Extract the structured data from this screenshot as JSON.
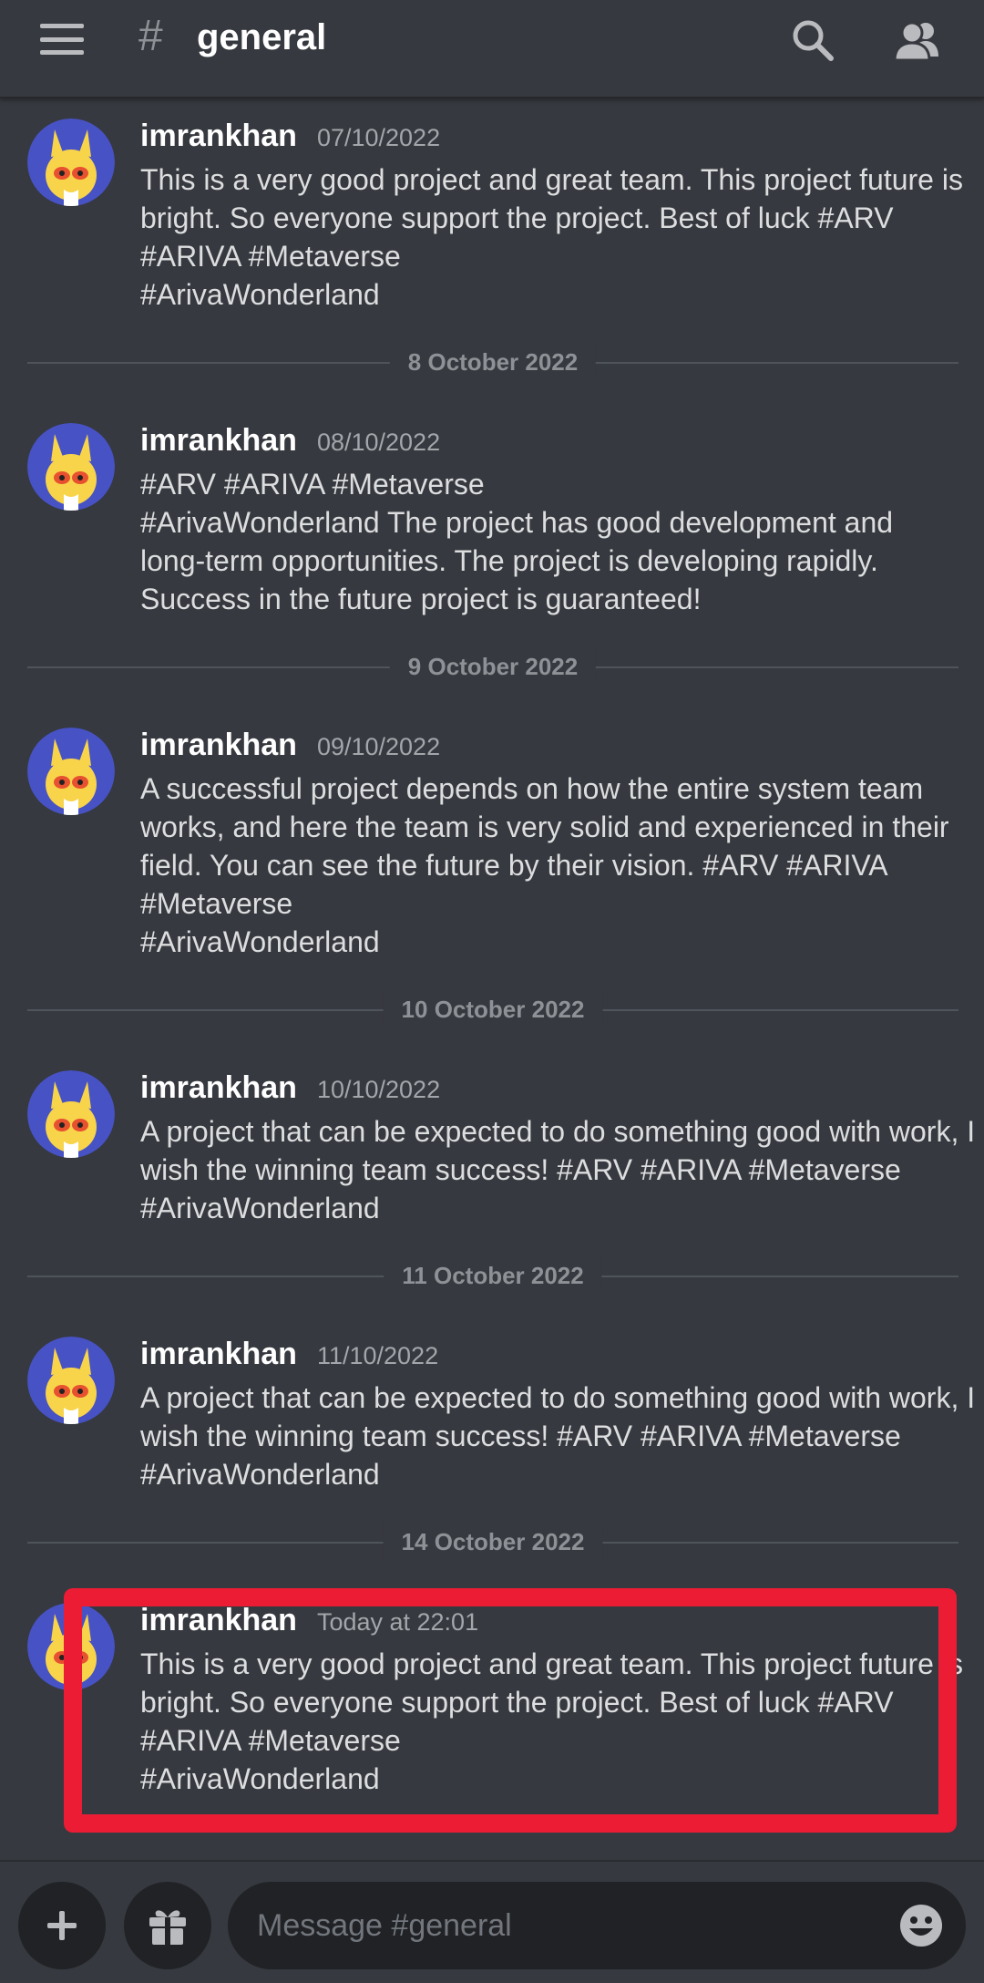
{
  "header": {
    "hash_symbol": "#",
    "channel_name": "general"
  },
  "messages": [
    {
      "username": "imrankhan",
      "timestamp": "07/10/2022",
      "lines": [
        "This is a very good project and great team. This project future is",
        "bright. So everyone support the project. Best of luck #ARV",
        "#ARIVA #Metaverse",
        "#ArivaWonderland"
      ]
    },
    {
      "username": "imrankhan",
      "timestamp": "08/10/2022",
      "lines": [
        "#ARV #ARIVA #Metaverse",
        "#ArivaWonderland The project has good development and",
        "long-term opportunities. The project is developing rapidly.",
        "Success in the future project is guaranteed!"
      ]
    },
    {
      "username": "imrankhan",
      "timestamp": "09/10/2022",
      "lines": [
        "A successful project depends on how the entire system team",
        "works, and here the team is very solid and experienced in their",
        "field. You can see the future by their vision. #ARV #ARIVA",
        "#Metaverse",
        "#ArivaWonderland"
      ]
    },
    {
      "username": "imrankhan",
      "timestamp": "10/10/2022",
      "lines": [
        "A project that can be expected to do something good with work, I",
        "wish the winning team success! #ARV #ARIVA #Metaverse",
        "#ArivaWonderland"
      ]
    },
    {
      "username": "imrankhan",
      "timestamp": "11/10/2022",
      "lines": [
        "A project that can be expected to do something good with work, I",
        "wish the winning team success! #ARV #ARIVA #Metaverse",
        "#ArivaWonderland"
      ]
    },
    {
      "username": "imrankhan",
      "timestamp": "Today at 22:01",
      "lines": [
        "This is a very good project and great team. This project future is",
        "bright. So everyone support the project. Best of luck #ARV",
        "#ARIVA #Metaverse",
        "#ArivaWonderland"
      ]
    }
  ],
  "date_dividers": [
    "8 October 2022",
    "9 October 2022",
    "10 October 2022",
    "11 October 2022",
    "14 October 2022"
  ],
  "composer": {
    "placeholder": "Message #general"
  },
  "icons": {
    "menu": "hamburger-menu-icon",
    "search": "search-icon",
    "members": "members-icon",
    "add": "plus-icon",
    "gift": "gift-icon",
    "emoji": "emoji-icon"
  },
  "colors": {
    "background": "#36393f",
    "input_background": "#202225",
    "highlight_border": "#ed1c35",
    "avatar_background": "#4752c4",
    "avatar_face": "#f8d44b"
  }
}
